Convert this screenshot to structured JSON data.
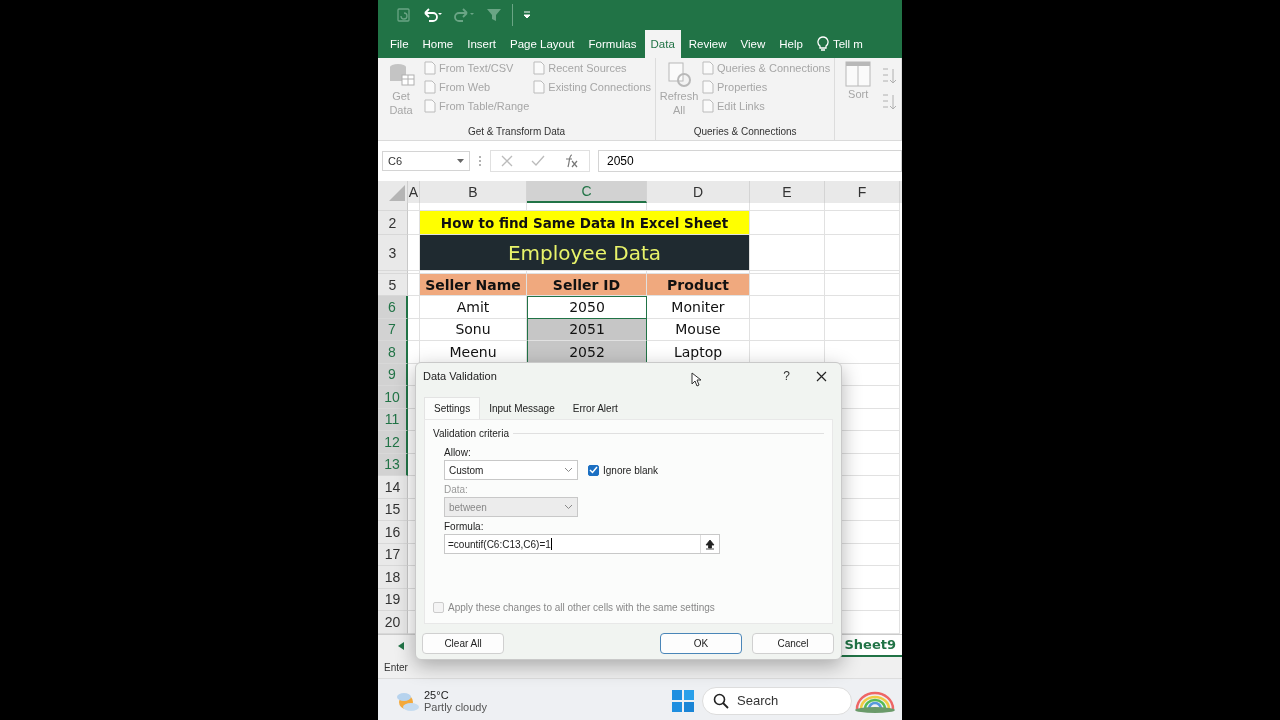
{
  "ribbon_tabs": [
    {
      "label": "File",
      "selected": false
    },
    {
      "label": "Home",
      "selected": false
    },
    {
      "label": "Insert",
      "selected": false
    },
    {
      "label": "Page Layout",
      "selected": false
    },
    {
      "label": "Formulas",
      "selected": false
    },
    {
      "label": "Data",
      "selected": true
    },
    {
      "label": "Review",
      "selected": false
    },
    {
      "label": "View",
      "selected": false
    },
    {
      "label": "Help",
      "selected": false
    }
  ],
  "tell_me": "Tell m",
  "ribbon_groups": [
    {
      "label": "Get & Transform Data",
      "large": [
        {
          "label": "Get Data",
          "disabled": true
        }
      ],
      "columns": [
        [
          {
            "label": "From Text/CSV",
            "disabled": true
          },
          {
            "label": "From Web",
            "disabled": true
          },
          {
            "label": "From Table/Range",
            "disabled": true
          }
        ],
        [
          {
            "label": "Recent Sources",
            "disabled": true
          },
          {
            "label": "Existing Connections",
            "disabled": true
          }
        ]
      ]
    },
    {
      "label": "Queries & Connections",
      "large": [
        {
          "label": "Refresh All",
          "disabled": true
        }
      ],
      "columns": [
        [
          {
            "label": "Queries & Connections",
            "disabled": true
          },
          {
            "label": "Properties",
            "disabled": true
          },
          {
            "label": "Edit Links",
            "disabled": true
          }
        ]
      ]
    },
    {
      "kind": "sort",
      "large": [
        {
          "label": "Sort",
          "disabled": true
        }
      ]
    }
  ],
  "name_box": "C6",
  "formula_bar": "2050",
  "columns": [
    {
      "label": "A",
      "selected": false
    },
    {
      "label": "B",
      "selected": false
    },
    {
      "label": "C",
      "selected": true
    },
    {
      "label": "D",
      "selected": false
    },
    {
      "label": "E",
      "selected": false
    },
    {
      "label": "F",
      "selected": false
    }
  ],
  "rows": [
    {
      "number": "2",
      "kind": "title",
      "selected": false,
      "cells": [
        {
          "text": "How to find Same Data In Excel Sheet"
        }
      ]
    },
    {
      "number": "3",
      "kind": "banner",
      "selected": false,
      "cells": [
        {
          "text": "Employee Data"
        }
      ]
    },
    {
      "number": "5",
      "kind": "header",
      "selected": false,
      "cells": [
        {
          "text": "Seller Name"
        },
        {
          "text": "Seller ID"
        },
        {
          "text": "Product"
        }
      ]
    },
    {
      "number": "6",
      "kind": "data",
      "selected": true,
      "cells": [
        {
          "text": "Amit",
          "selected": false
        },
        {
          "text": "2050",
          "selected": true
        },
        {
          "text": "Moniter",
          "selected": false
        }
      ]
    },
    {
      "number": "7",
      "kind": "data",
      "selected": true,
      "cells": [
        {
          "text": "Sonu",
          "selected": false
        },
        {
          "text": "2051",
          "selected": true
        },
        {
          "text": "Mouse",
          "selected": false
        }
      ]
    },
    {
      "number": "8",
      "kind": "data",
      "selected": true,
      "cells": [
        {
          "text": "Meenu",
          "selected": false
        },
        {
          "text": "2052",
          "selected": true
        },
        {
          "text": "Laptop",
          "selected": false
        }
      ]
    },
    {
      "number": "9",
      "kind": "empty",
      "selected": true
    },
    {
      "number": "10",
      "kind": "empty",
      "selected": true
    },
    {
      "number": "11",
      "kind": "empty",
      "selected": true
    },
    {
      "number": "12",
      "kind": "empty",
      "selected": true
    },
    {
      "number": "13",
      "kind": "empty",
      "selected": true
    },
    {
      "number": "14",
      "kind": "empty",
      "selected": false
    },
    {
      "number": "15",
      "kind": "empty",
      "selected": false
    },
    {
      "number": "16",
      "kind": "empty",
      "selected": false
    },
    {
      "number": "17",
      "kind": "empty",
      "selected": false
    },
    {
      "number": "18",
      "kind": "empty",
      "selected": false
    },
    {
      "number": "19",
      "kind": "empty",
      "selected": false
    },
    {
      "number": "20",
      "kind": "empty",
      "selected": false
    }
  ],
  "sheet_tab": "Sheet9",
  "status": "Enter",
  "dialog": {
    "title": "Data Validation",
    "help": "?",
    "tabs": [
      {
        "label": "Settings",
        "selected": true
      },
      {
        "label": "Input Message",
        "selected": false
      },
      {
        "label": "Error Alert",
        "selected": false
      }
    ],
    "section": "Validation criteria",
    "allow": {
      "label": "Allow:",
      "value": "Custom"
    },
    "ignore_blank": {
      "label": "Ignore blank",
      "checked": true
    },
    "data": {
      "label": "Data:",
      "value": "between",
      "disabled": true
    },
    "formula": {
      "label": "Formula:",
      "value": "=countif(C6:C13,C6)=1"
    },
    "apply_all": {
      "label": "Apply these changes to all other cells with the same settings",
      "checked": false,
      "disabled": true
    },
    "buttons": [
      {
        "label": "Clear All",
        "default": false
      },
      {
        "label": "OK",
        "default": true
      },
      {
        "label": "Cancel",
        "default": false
      }
    ]
  },
  "taskbar": {
    "temperature": "25°C",
    "weather": "Partly cloudy",
    "search": "Search"
  }
}
